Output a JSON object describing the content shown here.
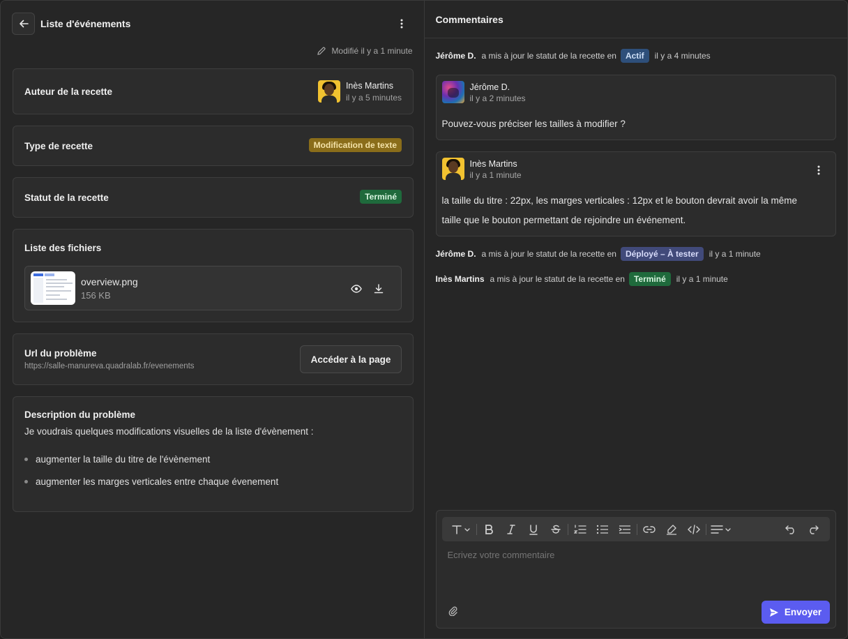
{
  "header": {
    "title": "Liste d'événements",
    "modified": "Modifié il y a 1 minute"
  },
  "author_card": {
    "label": "Auteur de la recette",
    "name": "Inès Martins",
    "time": "il y a 5 minutes"
  },
  "type_card": {
    "label": "Type de recette",
    "badge": "Modification de texte",
    "badge_color": "#8a6d1a"
  },
  "status_card": {
    "label": "Statut de la recette",
    "badge": "Terminé",
    "badge_color": "#1f6a3c"
  },
  "files_card": {
    "label": "Liste des fichiers",
    "files": [
      {
        "name": "overview.png",
        "size": "156 KB"
      }
    ]
  },
  "url_card": {
    "label": "Url du problème",
    "url": "https://salle-manureva.quadralab.fr/evenements",
    "button": "Accéder à la page"
  },
  "description_card": {
    "label": "Description du problème",
    "text": "Je voudrais quelques modifications visuelles de la liste d'évènement :",
    "bullets": [
      "augmenter la taille du titre de l'évènement",
      "augmenter les marges verticales entre chaque évenement"
    ]
  },
  "comments": {
    "title": "Commentaires",
    "activities": [
      {
        "who": "Jérôme D.",
        "text": "a mis à jour le statut de la recette en",
        "badge": "Actif",
        "when": "il y a 4 minutes"
      },
      {
        "who": "Jérôme D.",
        "text": "a mis à jour le statut de la recette en",
        "badge": "Déployé – À tester",
        "when": "il y a 1 minute"
      },
      {
        "who": "Inès Martins",
        "text": "a mis à jour le statut de la recette en",
        "badge": "Terminé",
        "when": "il y a 1 minute"
      }
    ],
    "items": [
      {
        "name": "Jérôme D.",
        "time": "il y a 2 minutes",
        "body": "Pouvez-vous préciser les tailles à modifier ?"
      },
      {
        "name": "Inès Martins",
        "time": "il y a 1 minute",
        "body_line1": "la taille du titre : 22px, les marges verticales : 12px et le bouton devrait avoir la même",
        "body_line2": "taille que le bouton permettant de rejoindre un événement."
      }
    ]
  },
  "editor": {
    "placeholder": "Ecrivez votre commentaire",
    "send": "Envoyer",
    "toolbar_icons": [
      "text-style-icon",
      "bold-icon",
      "italic-icon",
      "underline-icon",
      "strikethrough-icon",
      "ordered-list-icon",
      "bullet-list-icon",
      "indent-icon",
      "link-icon",
      "highlight-icon",
      "code-icon",
      "align-icon",
      "undo-icon",
      "redo-icon"
    ]
  },
  "colors": {
    "accent": "#5b5cf0",
    "status_active": "#2e4f7a",
    "status_deployed": "#414a7a",
    "status_done": "#1f6a3c"
  }
}
